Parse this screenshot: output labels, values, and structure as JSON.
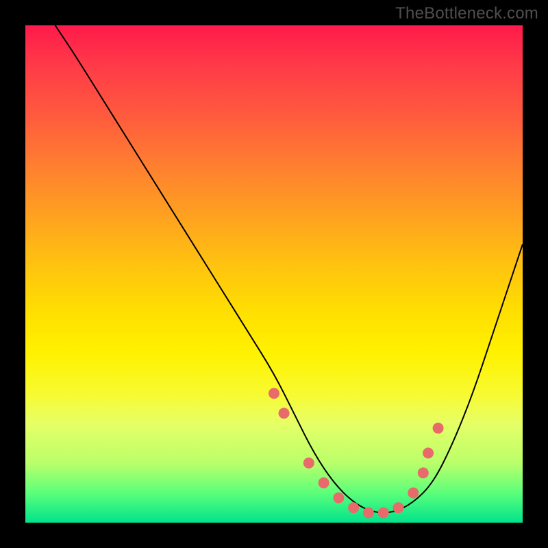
{
  "watermark": "TheBottleneck.com",
  "chart_data": {
    "type": "line",
    "title": "",
    "xlabel": "",
    "ylabel": "",
    "xlim": [
      0,
      100
    ],
    "ylim": [
      0,
      100
    ],
    "grid": false,
    "legend": false,
    "series": [
      {
        "name": "curve",
        "x": [
          6,
          10,
          15,
          20,
          25,
          30,
          35,
          40,
          45,
          50,
          54,
          58,
          62,
          66,
          70,
          74,
          78,
          82,
          86,
          90,
          94,
          98,
          100
        ],
        "y": [
          100,
          94,
          86,
          78,
          70,
          62,
          54,
          46,
          38,
          30,
          22,
          14,
          8,
          4,
          2,
          2,
          4,
          8,
          16,
          26,
          38,
          50,
          56
        ]
      }
    ],
    "markers": {
      "name": "marker-dots",
      "color": "#e86a6a",
      "radius_px": 8,
      "x": [
        50,
        52,
        57,
        60,
        63,
        66,
        69,
        72,
        75,
        78,
        80,
        81,
        83
      ],
      "y": [
        26,
        22,
        12,
        8,
        5,
        3,
        2,
        2,
        3,
        6,
        10,
        14,
        19
      ]
    },
    "background_gradient": {
      "direction": "vertical",
      "stops": [
        {
          "pos": 0.0,
          "color": "#ff1a4b"
        },
        {
          "pos": 0.5,
          "color": "#ffd800"
        },
        {
          "pos": 0.8,
          "color": "#f0ff50"
        },
        {
          "pos": 1.0,
          "color": "#00e38c"
        }
      ]
    }
  }
}
